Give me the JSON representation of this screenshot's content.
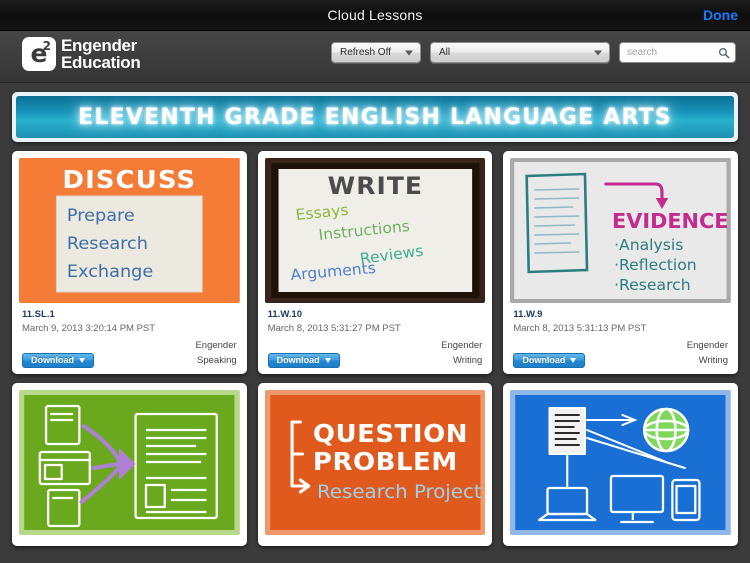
{
  "titlebar": {
    "title": "Cloud Lessons",
    "done_label": "Done"
  },
  "toolbar": {
    "logo_mark": "e",
    "logo_sup": "2",
    "logo_line1": "Engender",
    "logo_line2": "Education",
    "refresh_select": "Refresh Off",
    "filter_select": "All",
    "search_placeholder": "search",
    "search_value": "",
    "search_icon": "search-icon"
  },
  "banner": {
    "title": "ELEVENTH GRADE ENGLISH LANGUAGE ARTS",
    "accent": "#29b1cf"
  },
  "download_label": "Download",
  "cards": [
    {
      "code": "11.SL.1",
      "date": "March 9, 2013 3:20:14 PM PST",
      "publisher": "Engender",
      "subject": "Speaking",
      "art": "discuss",
      "bg": "#f57c36",
      "heading": "DISCUSS",
      "lines": [
        "Prepare",
        "Research",
        "Exchange"
      ]
    },
    {
      "code": "11.W.10",
      "date": "March 8, 2013 5:31:27 PM PST",
      "publisher": "Engender",
      "subject": "Writing",
      "art": "write",
      "bg": "#3a2318",
      "heading": "WRITE",
      "lines": [
        "Essays",
        "Instructions",
        "Reviews",
        "Arguments"
      ]
    },
    {
      "code": "11.W.9",
      "date": "March 8, 2013 5:31:13 PM PST",
      "publisher": "Engender",
      "subject": "Writing",
      "art": "evidence",
      "bg": "#e8e8e8",
      "heading": "EVIDENCE",
      "lines": [
        "Analysis",
        "Reflection",
        "Research"
      ]
    },
    {
      "code": "",
      "date": "",
      "publisher": "",
      "subject": "",
      "art": "sources",
      "bg": "#6aa81e",
      "heading": "",
      "lines": []
    },
    {
      "code": "",
      "date": "",
      "publisher": "",
      "subject": "",
      "art": "question",
      "bg": "#e05a1e",
      "heading": "QUESTION PROBLEM",
      "lines": [
        "Research Project"
      ]
    },
    {
      "code": "",
      "date": "",
      "publisher": "",
      "subject": "",
      "art": "devices",
      "bg": "#1a6fd4",
      "heading": "",
      "lines": []
    }
  ]
}
